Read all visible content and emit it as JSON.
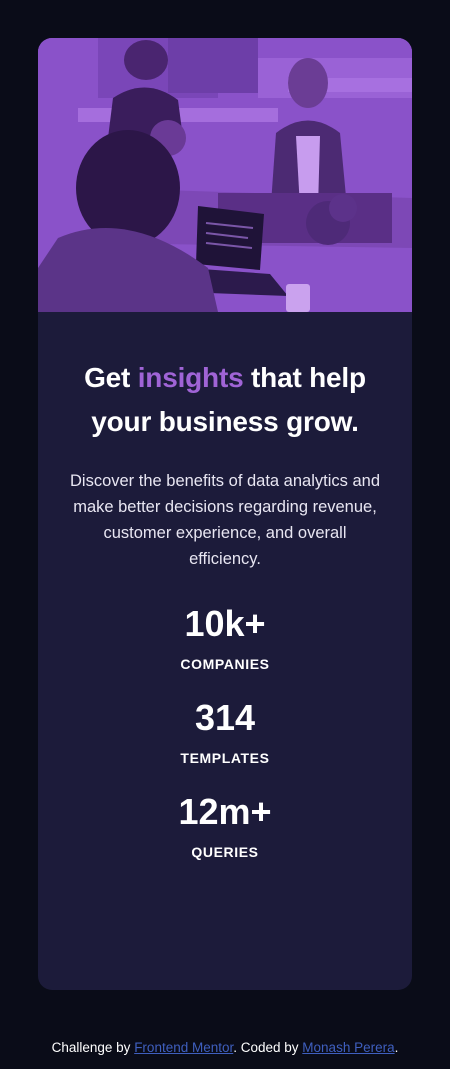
{
  "card": {
    "headline": {
      "before": "Get ",
      "accent": "insights",
      "after": " that help your business grow."
    },
    "description": "Discover the benefits of data analytics and make better decisions regarding revenue, customer experience, and overall efficiency.",
    "stats": [
      {
        "value": "10k+",
        "label": "COMPANIES"
      },
      {
        "value": "314",
        "label": "TEMPLATES"
      },
      {
        "value": "12m+",
        "label": "QUERIES"
      }
    ]
  },
  "footer": {
    "prefix": "Challenge by ",
    "link1": "Frontend Mentor",
    "middle": ". Coded by ",
    "link2": "Monash Perera",
    "suffix": "."
  },
  "colors": {
    "page_bg": "#0a0c18",
    "card_bg": "#1c1b3a",
    "accent": "#a064d6",
    "image_overlay": "#8a52c9",
    "link": "#3f5fbf"
  }
}
